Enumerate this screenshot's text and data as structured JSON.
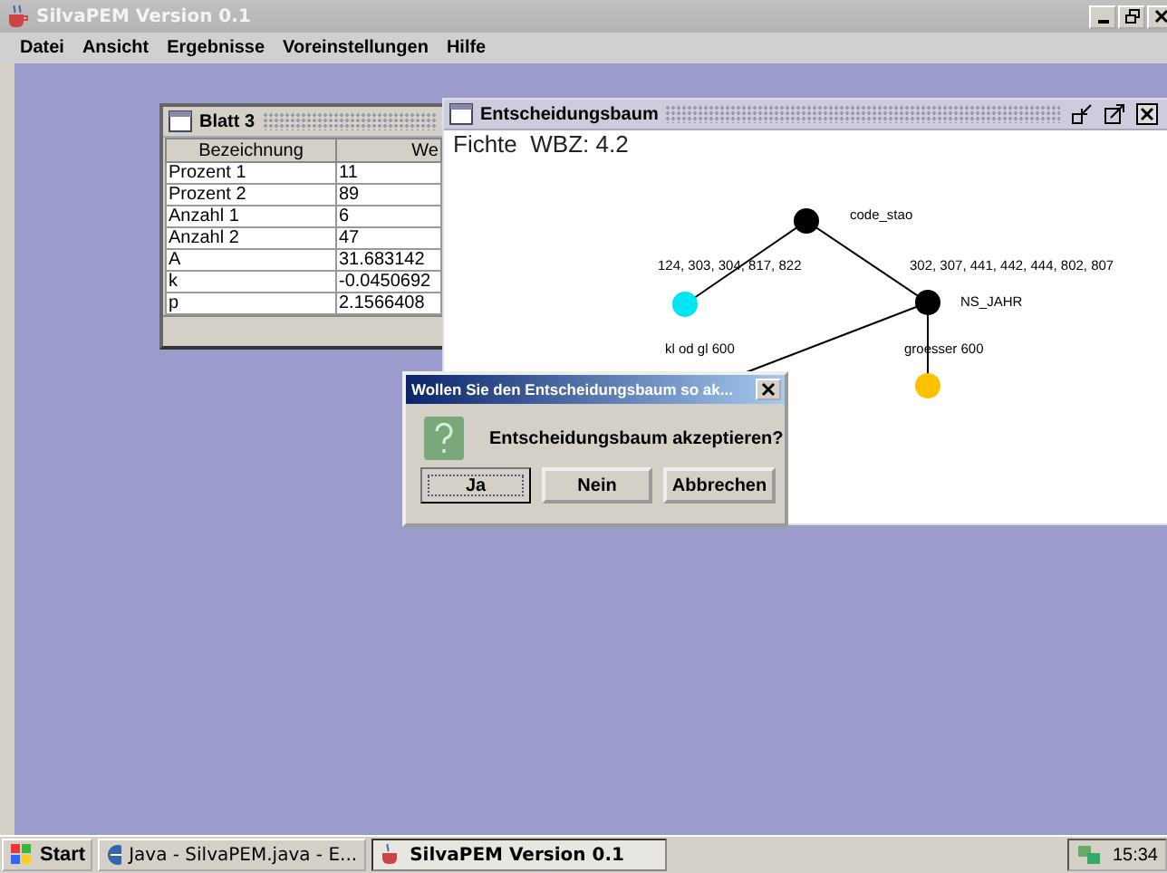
{
  "window": {
    "title": "SilvaPEM Version 0.1"
  },
  "menu": [
    "Datei",
    "Ansicht",
    "Ergebnisse",
    "Voreinstellungen",
    "Hilfe"
  ],
  "table_frame": {
    "title": "Blatt 3",
    "columns": [
      "Bezeichnung",
      "We"
    ],
    "rows": [
      [
        "Prozent 1",
        "11"
      ],
      [
        "Prozent 2",
        "89"
      ],
      [
        "Anzahl 1",
        "6"
      ],
      [
        "Anzahl 2",
        "47"
      ],
      [
        "A",
        "31.683142"
      ],
      [
        "k",
        "-0.0450692"
      ],
      [
        "p",
        "2.1566408"
      ]
    ]
  },
  "tree_frame": {
    "title": "Entscheidungsbaum",
    "heading": "Fichte  WBZ: 4.2",
    "nodes": [
      {
        "label": "code_stao",
        "color": "#000000"
      },
      {
        "color": "#00e5f0"
      },
      {
        "label": "NS_JAHR",
        "color": "#000000"
      },
      {
        "color": "#ffc000"
      }
    ],
    "edge_labels": [
      "124, 303, 304, 817, 822",
      "302, 307, 441, 442, 444, 802, 807",
      "kl od gl 600",
      "groesser 600"
    ]
  },
  "dialog": {
    "title": "Wollen Sie den Entscheidungsbaum so ak...",
    "message": "Entscheidungsbaum akzeptieren?",
    "buttons": [
      {
        "label": "Ja",
        "selected": true
      },
      {
        "label": "Nein",
        "selected": false
      },
      {
        "label": "Abbrechen",
        "selected": false
      }
    ]
  },
  "taskbar": {
    "start": "Start",
    "tasks": [
      {
        "label": "Java - SilvaPEM.java - E...",
        "selected": false
      },
      {
        "label": "SilvaPEM Version 0.1",
        "selected": true
      }
    ],
    "clock": "15:34"
  }
}
